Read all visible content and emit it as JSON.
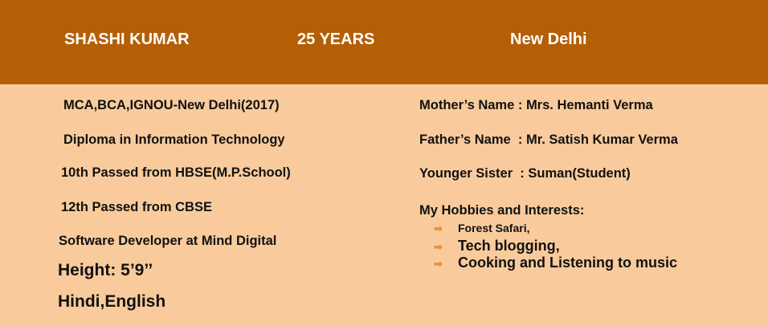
{
  "header": {
    "name": "SHASHI KUMAR",
    "age": "25 YEARS",
    "city": "New Delhi"
  },
  "left": [
    "MCA,BCA,IGNOU-New Delhi(2017)",
    "Diploma in Information Technology",
    "10th Passed from HBSE(M.P.School)",
    "12th Passed from CBSE",
    "Software Developer at Mind Digital",
    "Height: 5’9’’",
    "Hindi,English"
  ],
  "right": {
    "mother": "Mother’s Name : Mrs. Hemanti Verma",
    "father": "Father’s Name  : Mr. Satish Kumar Verma",
    "sister": "Younger Sister  : Suman(Student)",
    "hobbies_title": "My Hobbies and Interests:",
    "hobbies": [
      "Forest Safari,",
      "Tech blogging,",
      "Cooking and Listening to music"
    ]
  },
  "colors": {
    "header": "#b45f06",
    "background": "#f9cb9c",
    "bullet": "#e69138"
  }
}
